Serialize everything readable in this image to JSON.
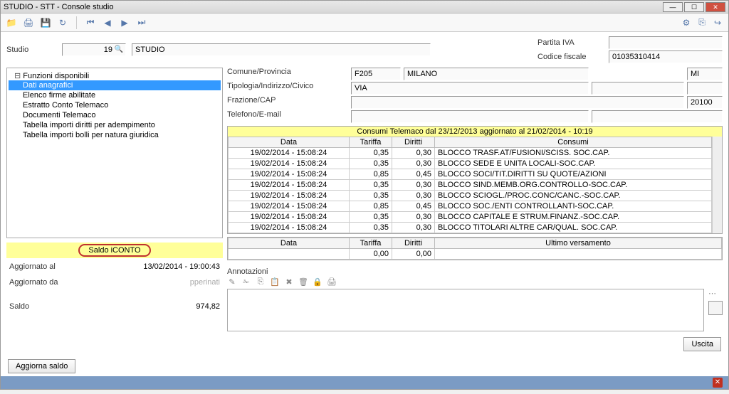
{
  "window": {
    "title": "STUDIO - STT - Console studio"
  },
  "header": {
    "studio_label": "Studio",
    "studio_number": "19",
    "studio_name": "STUDIO",
    "partita_iva_label": "Partita IVA",
    "partita_iva": "",
    "codice_fiscale_label": "Codice fiscale",
    "codice_fiscale": "01035310414"
  },
  "tree": {
    "root": "Funzioni disponibili",
    "items": [
      "Dati anagrafici",
      "Elenco firme abilitate",
      "Estratto Conto Telemaco",
      "Documenti Telemaco",
      "Tabella importi diritti per adempimento",
      "Tabella importi bolli per natura giuridica"
    ]
  },
  "saldo": {
    "title": "Saldo iCONTO",
    "agg_al_label": "Aggiornato al",
    "agg_al": "13/02/2014 - 19:00:43",
    "agg_da_label": "Aggiornato da",
    "agg_da": "pperinati",
    "saldo_label": "Saldo",
    "saldo_val": "974,82",
    "aggiorna_btn": "Aggiorna saldo"
  },
  "info": {
    "comune_lbl": "Comune/Provincia",
    "comune_code": "F205",
    "comune_name": "MILANO",
    "prov": "MI",
    "tipologia_lbl": "Tipologia/Indirizzo/Civico",
    "tipologia_val": "VIA",
    "indirizzo": "",
    "civico": "",
    "frazione_lbl": "Frazione/CAP",
    "frazione": "",
    "cap": "20100",
    "tel_lbl": "Telefono/E-mail",
    "tel": "",
    "email": ""
  },
  "consumi": {
    "title": "Consumi Telemaco dal 23/12/2013 aggiornato al 21/02/2014 - 10:19",
    "headers": {
      "data": "Data",
      "tariffa": "Tariffa",
      "diritti": "Diritti",
      "consumi": "Consumi"
    },
    "rows": [
      {
        "data": "19/02/2014 - 15:08:24",
        "tariffa": "0,35",
        "diritti": "0,30",
        "desc": "BLOCCO TRASF.AT/FUSIONI/SCISS. SOC.CAP."
      },
      {
        "data": "19/02/2014 - 15:08:24",
        "tariffa": "0,35",
        "diritti": "0,30",
        "desc": "BLOCCO SEDE E UNITA LOCALI-SOC.CAP."
      },
      {
        "data": "19/02/2014 - 15:08:24",
        "tariffa": "0,85",
        "diritti": "0,45",
        "desc": "BLOCCO SOCI/TIT.DIRITTI SU QUOTE/AZIONI"
      },
      {
        "data": "19/02/2014 - 15:08:24",
        "tariffa": "0,35",
        "diritti": "0,30",
        "desc": "BLOCCO SIND.MEMB.ORG.CONTROLLO-SOC.CAP."
      },
      {
        "data": "19/02/2014 - 15:08:24",
        "tariffa": "0,35",
        "diritti": "0,30",
        "desc": "BLOCCO SCIOGL./PROC.CONC/CANC.-SOC.CAP."
      },
      {
        "data": "19/02/2014 - 15:08:24",
        "tariffa": "0,85",
        "diritti": "0,45",
        "desc": "BLOCCO SOC./ENTI CONTROLLANTI-SOC.CAP."
      },
      {
        "data": "19/02/2014 - 15:08:24",
        "tariffa": "0,35",
        "diritti": "0,30",
        "desc": "BLOCCO CAPITALE E STRUM.FINANZ.-SOC.CAP."
      },
      {
        "data": "19/02/2014 - 15:08:24",
        "tariffa": "0,35",
        "diritti": "0,30",
        "desc": "BLOCCO TITOLARI ALTRE CAR/QUAL. SOC.CAP."
      }
    ],
    "footer_headers": {
      "data": "Data",
      "tariffa": "Tariffa",
      "diritti": "Diritti",
      "versamento": "Ultimo versamento"
    },
    "footer_row": {
      "data": "",
      "tariffa": "0,00",
      "diritti": "0,00",
      "versamento": ""
    }
  },
  "annotazioni": {
    "label": "Annotazioni"
  },
  "buttons": {
    "uscita": "Uscita"
  }
}
